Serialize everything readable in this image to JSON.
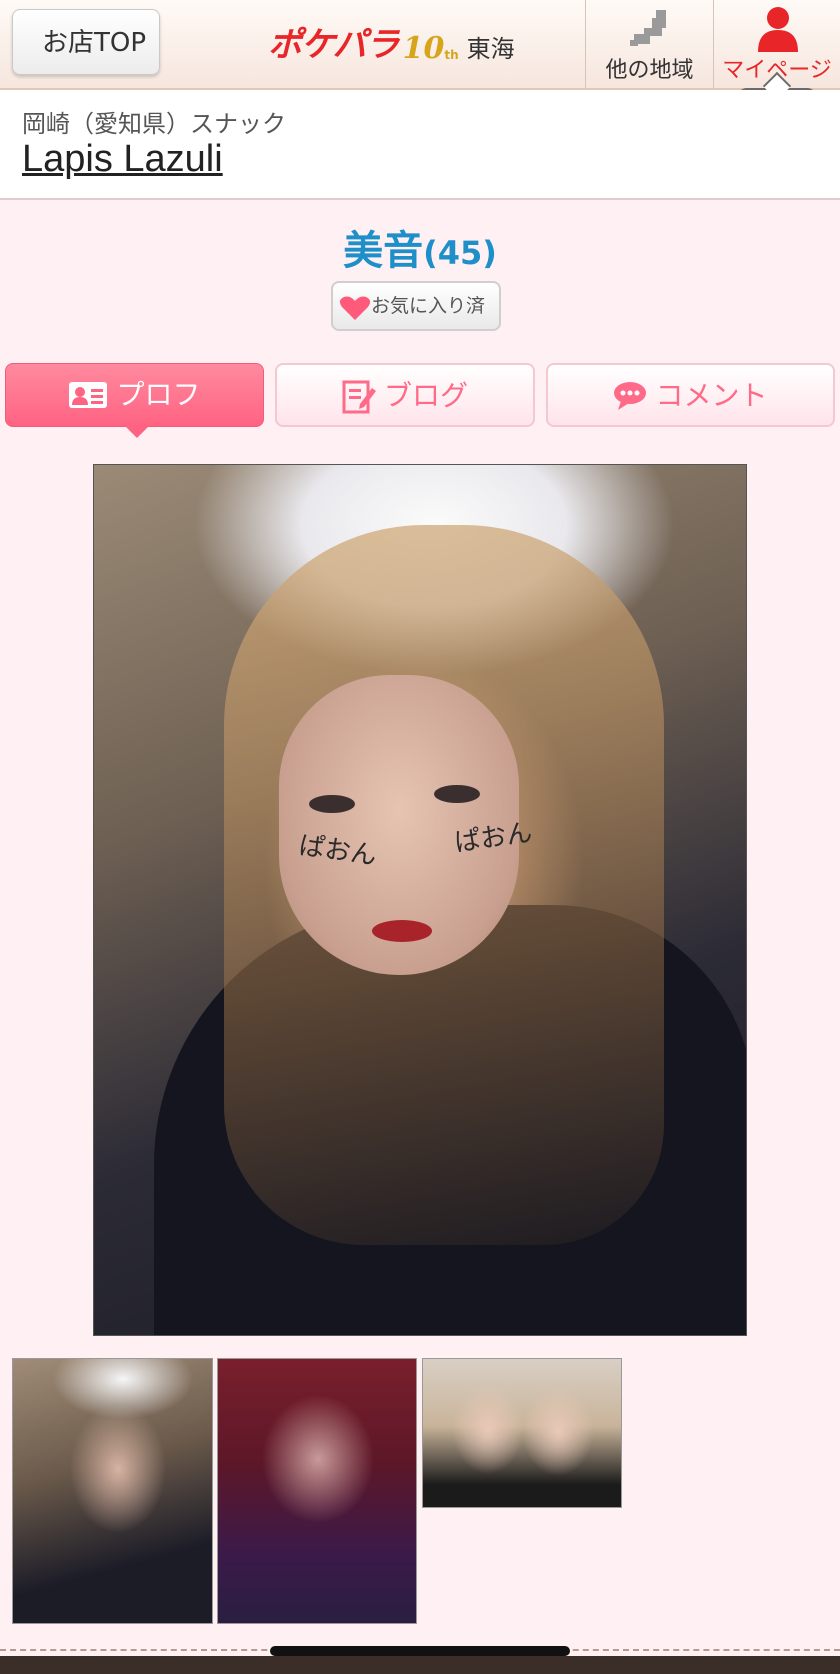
{
  "header": {
    "back_label": "お店TOP",
    "logo_text": "ポケパラ",
    "logo_anniversary": "10",
    "logo_anniversary_suffix": "th",
    "logo_region": "東海",
    "nav_other_label": "他の地域",
    "nav_my_label": "マイページ"
  },
  "shop": {
    "category": "岡崎（愛知県）スナック",
    "name": "Lapis Lazuli"
  },
  "profile": {
    "name": "美音",
    "age": "(45)",
    "favorite_label": "お気に入り済"
  },
  "tabs": [
    {
      "label": "プロフ",
      "icon": "profile-card-icon",
      "active": true
    },
    {
      "label": "ブログ",
      "icon": "blog-edit-icon",
      "active": false
    },
    {
      "label": "コメント",
      "icon": "comment-bubble-icon",
      "active": false
    }
  ],
  "photo_text": {
    "left_cheek": "ぱおん",
    "right_cheek": "ぱおん"
  },
  "colors": {
    "accent_pink": "#ff6382",
    "name_blue": "#1e8fc8",
    "logo_red": "#e8262a",
    "background": "#fff0f3"
  }
}
